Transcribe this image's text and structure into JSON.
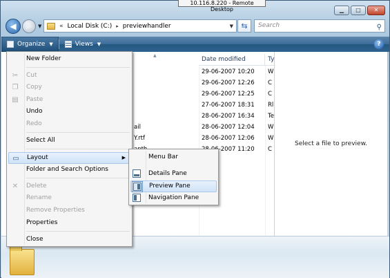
{
  "remote_desktop": {
    "title": "10.116.8.220 - Remote Desktop"
  },
  "address_bar": {
    "chevron": "«",
    "crumbs": [
      "Local Disk (C:)",
      "previewhandler"
    ],
    "separator": "▸"
  },
  "search": {
    "placeholder": "Search"
  },
  "toolbar": {
    "organize_label": "Organize",
    "views_label": "Views"
  },
  "file_list": {
    "columns": [
      "Date modified",
      "Ty"
    ],
    "rows": [
      {
        "name": "",
        "date": "29-06-2007 10:20",
        "type": "W"
      },
      {
        "name": "",
        "date": "29-06-2007 12:26",
        "type": "C"
      },
      {
        "name": "",
        "date": "29-06-2007 12:25",
        "type": "C"
      },
      {
        "name": "",
        "date": "27-06-2007 18:31",
        "type": "Rl"
      },
      {
        "name": "",
        "date": "28-06-2007 16:34",
        "type": "Te"
      },
      {
        "name": "ail",
        "date": "28-06-2007 12:04",
        "type": "W"
      },
      {
        "name": "Y.rtf",
        "date": "28-06-2007 12:06",
        "type": "W"
      },
      {
        "name": "anth",
        "date": "28-06-2007 11:20",
        "type": "C"
      }
    ]
  },
  "preview_pane": {
    "message": "Select a file to preview."
  },
  "organize_menu": {
    "new_folder": "New Folder",
    "cut": "Cut",
    "copy": "Copy",
    "paste": "Paste",
    "undo": "Undo",
    "redo": "Redo",
    "select_all": "Select All",
    "layout": "Layout",
    "folder_search_options": "Folder and Search Options",
    "delete": "Delete",
    "rename": "Rename",
    "remove_properties": "Remove Properties",
    "properties": "Properties",
    "close": "Close"
  },
  "layout_submenu": {
    "menu_bar": "Menu Bar",
    "details_pane": "Details Pane",
    "preview_pane": "Preview Pane",
    "navigation_pane": "Navigation Pane"
  }
}
